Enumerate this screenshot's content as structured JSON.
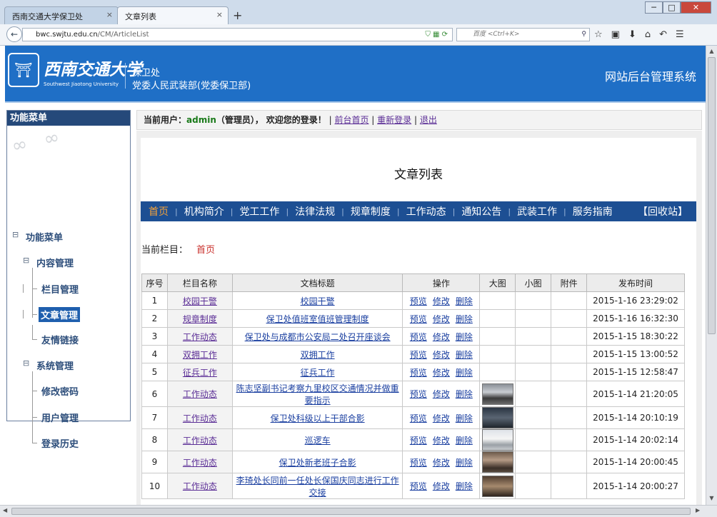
{
  "browser": {
    "tabs": [
      {
        "title": "西南交通大学保卫处",
        "close": "×"
      },
      {
        "title": "文章列表",
        "close": "×"
      }
    ],
    "new_tab": "+",
    "ghost_tab_text": "",
    "back_icon": "←",
    "url_host": "bwc.swjtu.edu.cn",
    "url_path": "/CM/ArticleList",
    "url_right_icons": "⛉ ▦ ⟳",
    "search_engine_icon": "🔍",
    "search_placeholder": "百度 <Ctrl+K>",
    "search_go": "⚲",
    "toolbar_icons": [
      "☆",
      "▣",
      "⬇",
      "⌂",
      "↶",
      "☰"
    ],
    "window_buttons": [
      "─",
      "□",
      "✕"
    ]
  },
  "header": {
    "logo_glyph": "⛩",
    "cn_name": "西南交通大学",
    "en_name": "Southwest Jiaotong University",
    "dept_line1": "保卫处",
    "dept_line2": "党委人民武装部(党委保卫部)",
    "system_title": "网站后台管理系统"
  },
  "sidebar": {
    "title": "功能菜单",
    "root": "功能菜单",
    "groups": [
      {
        "label": "内容管理",
        "items": [
          "栏目管理",
          "文章管理",
          "友情链接"
        ]
      },
      {
        "label": "系统管理",
        "items": [
          "修改密码",
          "用户管理",
          "登录历史"
        ]
      }
    ],
    "active_item": "文章管理",
    "collapse_glyph": "⊟"
  },
  "userbar": {
    "prefix": "当前用户：",
    "username": "admin",
    "role": "（管理员），",
    "welcome": "欢迎您的登录！",
    "sep": "|",
    "links": [
      "前台首页",
      "重新登录",
      "退出"
    ]
  },
  "page": {
    "title": "文章列表",
    "nav": [
      "首页",
      "机构简介",
      "党工工作",
      "法律法规",
      "规章制度",
      "工作动态",
      "通知公告",
      "武装工作",
      "服务指南"
    ],
    "nav_current": "首页",
    "nav_sep": "|",
    "recycle": "【回收站】",
    "current_label": "当前栏目：",
    "current_value": "首页"
  },
  "table": {
    "headers": [
      "序号",
      "栏目名称",
      "文档标题",
      "操作",
      "大图",
      "小图",
      "附件",
      "发布时间"
    ],
    "ops": [
      "预览",
      "修改",
      "删除"
    ],
    "rows": [
      {
        "no": "1",
        "cat": "校园干警",
        "title": "校园干警",
        "thumb": "",
        "time": "2015-1-16 23:29:02"
      },
      {
        "no": "2",
        "cat": "规章制度",
        "title": "保卫处值班室值班管理制度",
        "thumb": "",
        "time": "2015-1-16 16:32:30"
      },
      {
        "no": "3",
        "cat": "工作动态",
        "title": "保卫处与成都市公安局二处召开座谈会",
        "thumb": "",
        "time": "2015-1-15 18:30:22"
      },
      {
        "no": "4",
        "cat": "双拥工作",
        "title": "双拥工作",
        "thumb": "",
        "time": "2015-1-15 13:00:52"
      },
      {
        "no": "5",
        "cat": "征兵工作",
        "title": "征兵工作",
        "thumb": "",
        "time": "2015-1-15 12:58:47"
      },
      {
        "no": "6",
        "cat": "工作动态",
        "title": "陈志坚副书记考察九里校区交通情况并做重要指示",
        "thumb": "t1",
        "time": "2015-1-14 21:20:05"
      },
      {
        "no": "7",
        "cat": "工作动态",
        "title": "保卫处科级以上干部合影",
        "thumb": "t2",
        "time": "2015-1-14 20:10:19"
      },
      {
        "no": "8",
        "cat": "工作动态",
        "title": "巡逻车",
        "thumb": "t3",
        "time": "2015-1-14 20:02:14"
      },
      {
        "no": "9",
        "cat": "工作动态",
        "title": "保卫处新老班子合影",
        "thumb": "t4",
        "time": "2015-1-14 20:00:45"
      },
      {
        "no": "10",
        "cat": "工作动态",
        "title": "李琦处长同前一任处长保国庆同志进行工作交接",
        "thumb": "t5",
        "time": "2015-1-14 20:00:27"
      }
    ]
  },
  "scroll": {
    "up": "▲",
    "down": "▼",
    "left": "◀",
    "right": "▶",
    "grip": "⁞"
  }
}
